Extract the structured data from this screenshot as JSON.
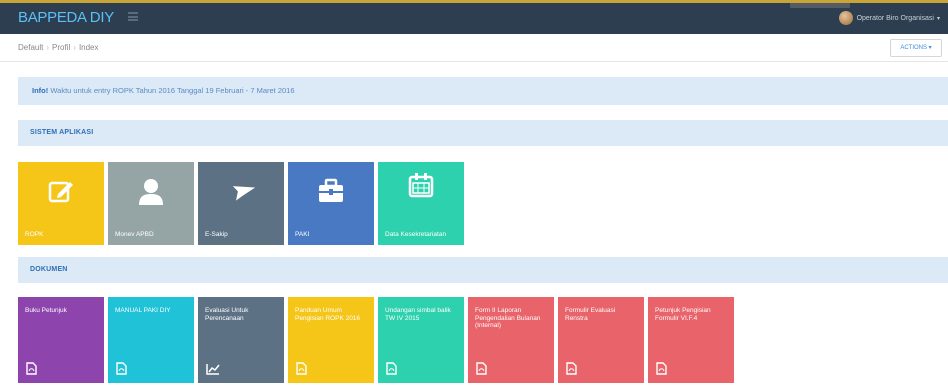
{
  "brand": {
    "title": "BAPPEDA DIY"
  },
  "user": {
    "name": "Operator Biro Organisasi"
  },
  "breadcrumb": [
    "Default",
    "Profil",
    "Index"
  ],
  "actions_label": "ACTIONS",
  "alert": {
    "prefix": "Info!",
    "text": "Waktu untuk entry ROPK Tahun 2016 Tanggal 19 Februari - 7 Maret 2016"
  },
  "sections": {
    "apps": "SISTEM APLIKASI",
    "docs": "DOKUMEN"
  },
  "apps": [
    {
      "label": "ROPK",
      "icon": "edit-icon",
      "color": "#f5c518"
    },
    {
      "label": "Monev APBD",
      "icon": "user-icon",
      "color": "#95a5a6"
    },
    {
      "label": "E-Sakip",
      "icon": "plane-icon",
      "color": "#5d7185"
    },
    {
      "label": "PAKI",
      "icon": "briefcase-icon",
      "color": "#4a79c4"
    },
    {
      "label": "Data Kesekretariatan",
      "icon": "calendar-icon",
      "color": "#2ed1ad"
    }
  ],
  "documents": [
    {
      "title": "Buku Petunjuk",
      "icon": "pdf-icon",
      "color": "#8e44ad"
    },
    {
      "title": "MANUAL PAKI DIY",
      "icon": "pdf-icon",
      "color": "#1fc2d6"
    },
    {
      "title": "Evaluasi Untuk Perencanaan",
      "icon": "chart-icon",
      "color": "#5d7185"
    },
    {
      "title": "Panduan Umum Pengisian ROPK 2016",
      "icon": "pdf-icon",
      "color": "#f5c518"
    },
    {
      "title": "Undangan simbal balik TW IV 2015",
      "icon": "pdf-icon",
      "color": "#2ed1ad"
    },
    {
      "title": "Form II Laporan Pengendalian Bulanan (Internal)",
      "icon": "pdf-icon",
      "color": "#e8636a"
    },
    {
      "title": "Formulir Evaluasi Renstra",
      "icon": "pdf-icon",
      "color": "#e8636a"
    },
    {
      "title": "Petunjuk Pengisian Formulir VI.F.4",
      "icon": "pdf-icon",
      "color": "#e8636a"
    }
  ]
}
